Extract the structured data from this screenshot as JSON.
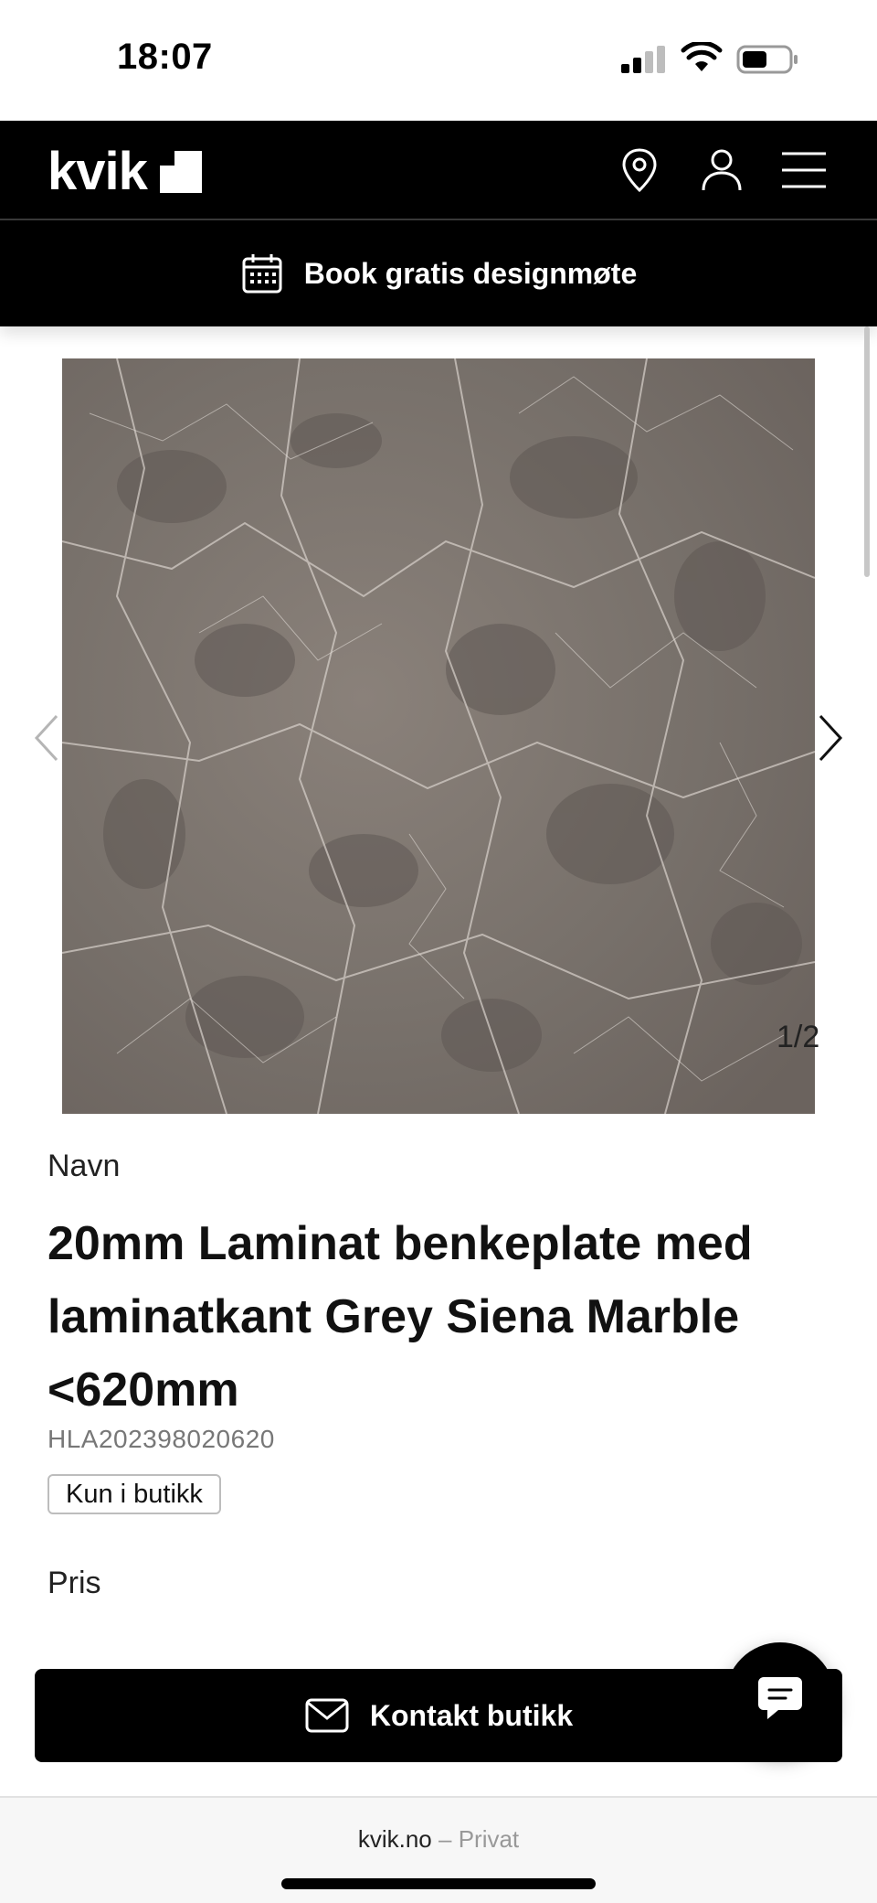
{
  "status_bar": {
    "time": "18:07"
  },
  "header": {
    "logo": "kvik",
    "icons": [
      "location-pin-icon",
      "user-icon",
      "hamburger-menu-icon"
    ]
  },
  "book_bar": {
    "label": "Book gratis designmøte",
    "icon": "calendar-icon"
  },
  "gallery": {
    "counter": "1/2"
  },
  "product": {
    "name_label": "Navn",
    "title": "20mm Laminat benkeplate med laminatkant Grey Siena Marble <620mm",
    "sku": "HLA202398020620",
    "badge": "Kun i butikk",
    "price_label": "Pris"
  },
  "contact": {
    "label": "Kontakt butikk",
    "icon": "envelope-icon"
  },
  "chat": {
    "icon": "chat-icon"
  },
  "browser": {
    "domain": "kvik.no",
    "separator": "–",
    "mode": "Privat"
  },
  "colors": {
    "header_bg": "#000000",
    "text": "#111111",
    "muted": "#777777"
  }
}
